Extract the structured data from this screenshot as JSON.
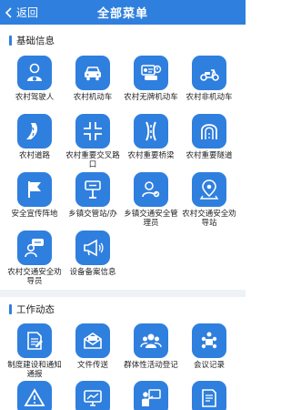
{
  "header": {
    "back_label": "返回",
    "title": "全部菜单"
  },
  "section_basic": {
    "title": "基础信息",
    "items": [
      {
        "label": "农村驾驶人",
        "icon": "driver-icon"
      },
      {
        "label": "农村机动车",
        "icon": "car-icon"
      },
      {
        "label": "农村无牌机动车",
        "icon": "unlicensed-vehicle-icon"
      },
      {
        "label": "农村非机动车",
        "icon": "scooter-icon"
      },
      {
        "label": "农村道路",
        "icon": "road-icon"
      },
      {
        "label": "农村重要交叉路口",
        "icon": "intersection-icon"
      },
      {
        "label": "农村重要桥梁",
        "icon": "bridge-icon"
      },
      {
        "label": "农村重要隧道",
        "icon": "tunnel-icon"
      },
      {
        "label": "安全宣传阵地",
        "icon": "flag-icon"
      },
      {
        "label": "乡镇交管站/办",
        "icon": "signpost-icon"
      },
      {
        "label": "乡镇交通安全管理员",
        "icon": "manager-icon"
      },
      {
        "label": "农村交通安全劝导站",
        "icon": "location-pin-icon"
      },
      {
        "label": "农村交通安全劝导员",
        "icon": "persuader-icon"
      },
      {
        "label": "设备备案信息",
        "icon": "loudspeaker-icon"
      }
    ]
  },
  "section_work": {
    "title": "工作动态",
    "items": [
      {
        "label": "制度建设和通知通报",
        "icon": "document-icon"
      },
      {
        "label": "文件传送",
        "icon": "mail-icon"
      },
      {
        "label": "群体性活动登记",
        "icon": "group-icon"
      },
      {
        "label": "会议记录",
        "icon": "meeting-icon"
      },
      {
        "label": "",
        "icon": "warning-icon"
      },
      {
        "label": "",
        "icon": "screen-icon"
      },
      {
        "label": "",
        "icon": "presenter-icon"
      },
      {
        "label": "",
        "icon": "report-icon"
      }
    ]
  },
  "colors": {
    "accent": "#2f7fde",
    "divider": "#eef1f5"
  }
}
